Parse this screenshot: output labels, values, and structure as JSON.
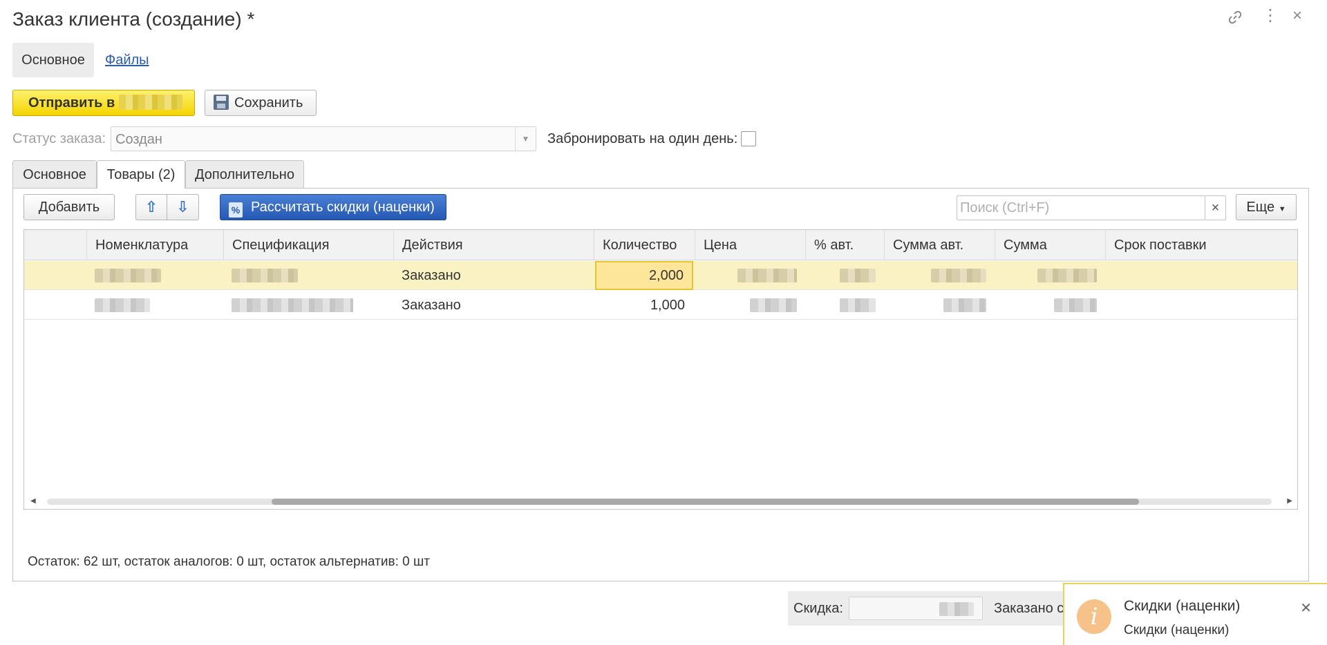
{
  "window": {
    "title": "Заказ клиента (создание) *"
  },
  "form_tabs": [
    {
      "label": "Основное"
    },
    {
      "label": "Файлы"
    }
  ],
  "toolbar": {
    "send_label": "Отправить в",
    "save_label": "Сохранить"
  },
  "status": {
    "label": "Статус заказа:",
    "value": "Создан",
    "reserve_label": "Забронировать на один день:",
    "reserve_checked": false
  },
  "inner_tabs": [
    {
      "label": "Основное"
    },
    {
      "label": "Товары (2)"
    },
    {
      "label": "Дополнительно"
    }
  ],
  "table_toolbar": {
    "add_label": "Добавить",
    "calc_label": "Рассчитать скидки (наценки)",
    "search_placeholder": "Поиск (Ctrl+F)",
    "search_clear": "×",
    "more_label": "Еще"
  },
  "grid": {
    "columns": [
      "Номенклатура",
      "Спецификация",
      "Действия",
      "Количество",
      "Цена",
      "% авт.",
      "Сумма авт.",
      "Сумма",
      "Срок поставки"
    ],
    "rows": [
      {
        "action": "Заказано",
        "quantity": "2,000"
      },
      {
        "action": "Заказано",
        "quantity": "1,000"
      }
    ]
  },
  "stock_text": "Остаток: 62 шт, остаток аналогов: 0 шт, остаток альтернатив: 0 шт",
  "footer": {
    "discount_label": "Скидка:",
    "ordered_label": "Заказано с"
  },
  "notification": {
    "title": "Скидки (наценки)",
    "text": "Скидки (наценки)"
  },
  "colors": {
    "accent_yellow": "#f4d400",
    "accent_blue": "#2458b4",
    "selected_row": "#fbf2c4",
    "link": "#2a5ca8"
  }
}
